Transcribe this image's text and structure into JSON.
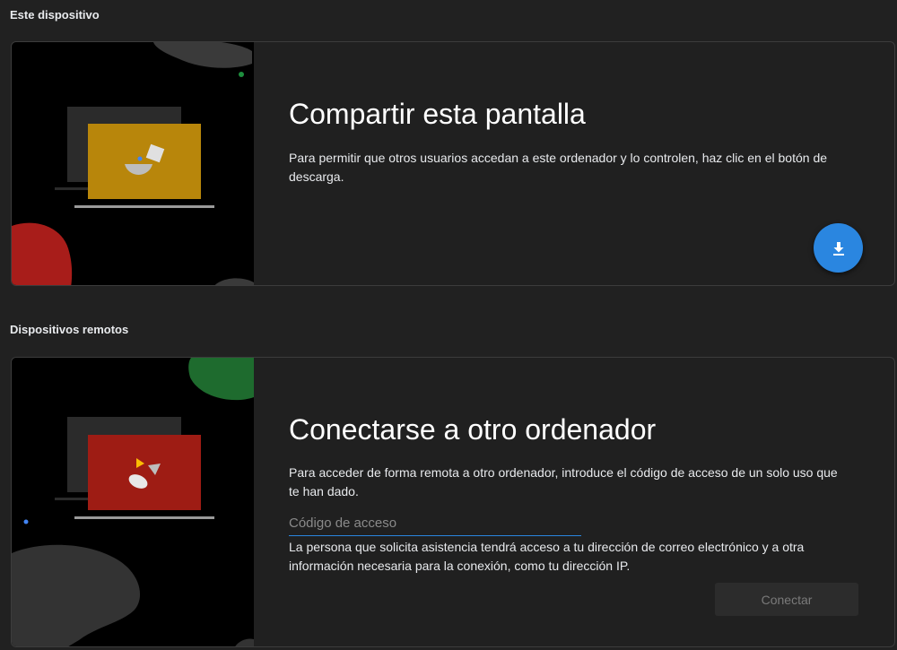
{
  "this_device": {
    "section_title": "Este dispositivo",
    "card_title": "Compartir esta pantalla",
    "description": "Para permitir que otros usuarios accedan a este ordenador y lo controlen, haz clic en el botón de descarga.",
    "download_icon": "download-icon"
  },
  "remote_devices": {
    "section_title": "Dispositivos remotos",
    "card_title": "Conectarse a otro ordenador",
    "description": "Para acceder de forma remota a otro ordenador, introduce el código de acceso de un solo uso que te han dado.",
    "access_code": {
      "placeholder": "Código de acceso",
      "value": ""
    },
    "privacy_note": "La persona que solicita asistencia tendrá acceso a tu dirección de correo electrónico y a otra información necesaria para la conexión, como tu dirección IP.",
    "connect_label": "Conectar"
  },
  "colors": {
    "accent": "#2a86e0",
    "share_screen": "#b8860b",
    "remote_screen": "#9e1c14"
  }
}
